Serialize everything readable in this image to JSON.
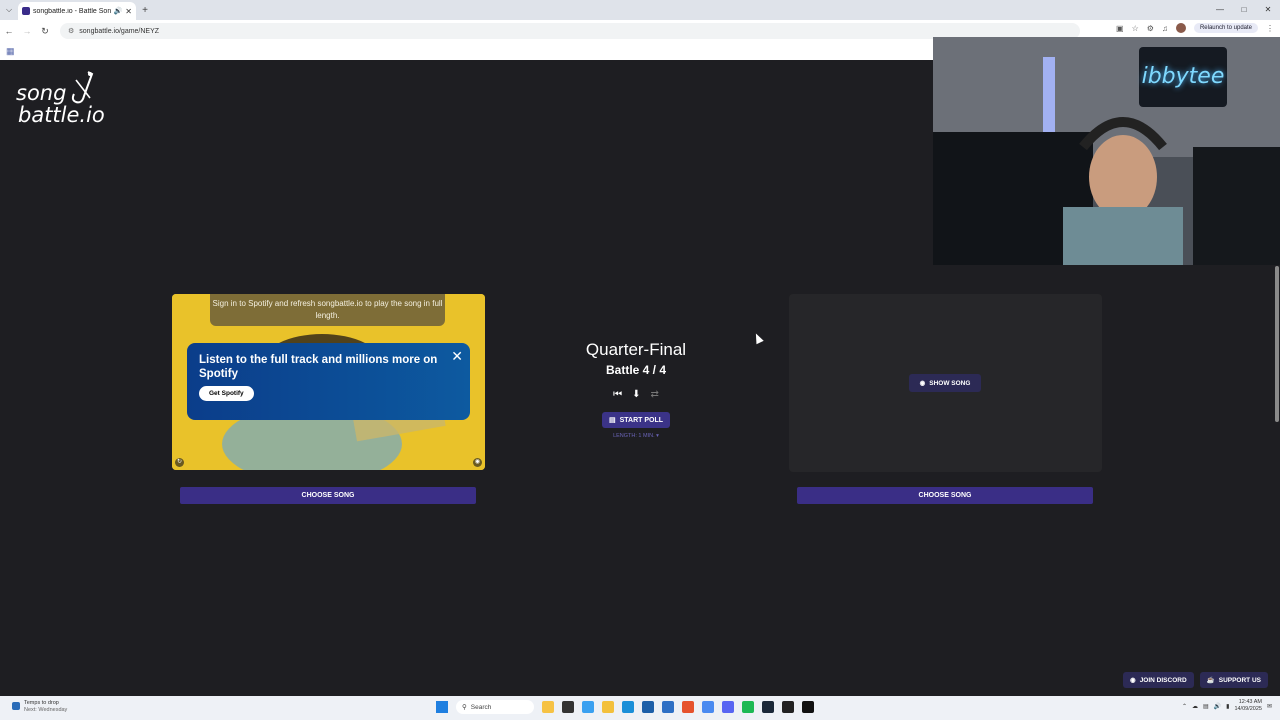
{
  "browser": {
    "tab_title": "songbattle.io - Battle Song...",
    "tab_audio_icon": "speaker-icon",
    "new_tab_label": "+",
    "url": "songbattle.io/game/NEYZ",
    "relaunch_label": "Relaunch to update"
  },
  "logo": {
    "line1": "song",
    "line2": "battle.io"
  },
  "left_card": {
    "signin_text": "Sign in to Spotify and refresh songbattle.io to play the song in full length.",
    "promo_text": "Listen to the full track and millions more on Spotify",
    "promo_button": "Get Spotify"
  },
  "center": {
    "round_title": "Quarter-Final",
    "battle_label": "Battle 4 / 4",
    "start_poll": "START POLL",
    "length_label": "LENGTH: 1 MIN. ▾"
  },
  "right_card": {
    "show_song": "SHOW SONG"
  },
  "choose_song_left": "CHOOSE SONG",
  "choose_song_right": "CHOOSE SONG",
  "footer": {
    "join_discord": "JOIN DISCORD",
    "support_us": "SUPPORT US"
  },
  "webcam": {
    "neon_sign": "ibbytee"
  },
  "taskbar": {
    "weather_line1": "Temps to drop",
    "weather_line2": "Next: Wednesday",
    "search_placeholder": "Search",
    "time": "12:43 AM",
    "date": "14/09/2025"
  },
  "colors": {
    "accent": "#3a2e86",
    "spotify_yellow": "#e9c22a",
    "page_bg": "#1e1e22"
  }
}
